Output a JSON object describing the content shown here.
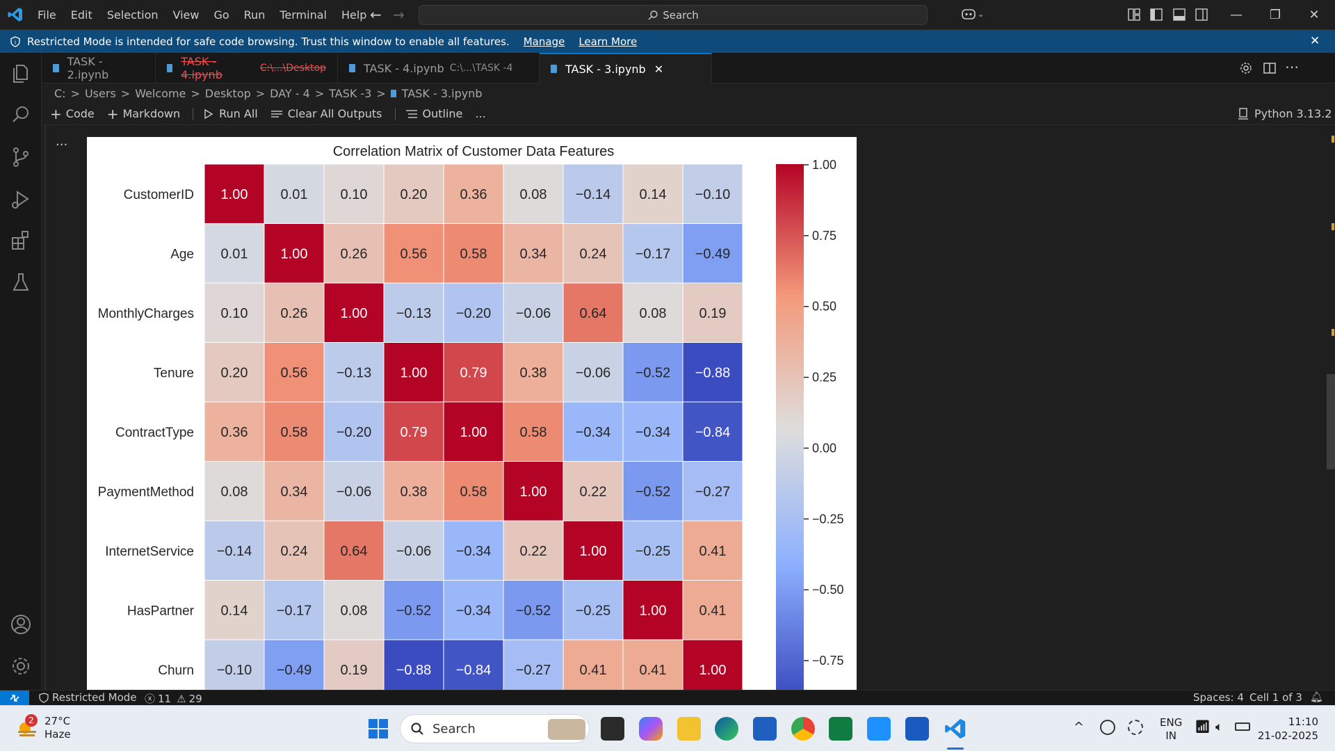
{
  "titlebar": {
    "menu": [
      "File",
      "Edit",
      "Selection",
      "View",
      "Go",
      "Run",
      "Terminal",
      "Help"
    ],
    "search_placeholder": "Search"
  },
  "banner": {
    "text": "Restricted Mode is intended for safe code browsing. Trust this window to enable all features.",
    "manage": "Manage",
    "learn_more": "Learn More"
  },
  "tabs": [
    {
      "label": "TASK - 2.ipynb",
      "desc": "",
      "state": "normal"
    },
    {
      "label": "TASK - 4.ipynb",
      "desc": "C:\\...\\Desktop",
      "state": "deleted"
    },
    {
      "label": "TASK - 4.ipynb",
      "desc": "C:\\...\\TASK -4",
      "state": "normal"
    },
    {
      "label": "TASK - 3.ipynb",
      "desc": "",
      "state": "active"
    }
  ],
  "breadcrumb": [
    "C:",
    "Users",
    "Welcome",
    "Desktop",
    "DAY - 4",
    "TASK -3",
    "TASK - 3.ipynb"
  ],
  "toolbar": {
    "code": "Code",
    "markdown": "Markdown",
    "run_all": "Run All",
    "clear_outputs": "Clear All Outputs",
    "outline": "Outline",
    "more": "...",
    "kernel": "Python 3.13.2"
  },
  "cell_more": "...",
  "chart_data": {
    "type": "heatmap",
    "title": "Correlation Matrix of Customer Data Features",
    "rows": [
      "CustomerID",
      "Age",
      "MonthlyCharges",
      "Tenure",
      "ContractType",
      "PaymentMethod",
      "InternetService",
      "HasPartner",
      "Churn"
    ],
    "values": [
      [
        1.0,
        0.01,
        0.1,
        0.2,
        0.36,
        0.08,
        -0.14,
        0.14,
        -0.1
      ],
      [
        0.01,
        1.0,
        0.26,
        0.56,
        0.58,
        0.34,
        0.24,
        -0.17,
        -0.49
      ],
      [
        0.1,
        0.26,
        1.0,
        -0.13,
        -0.2,
        -0.06,
        0.64,
        0.08,
        0.19
      ],
      [
        0.2,
        0.56,
        -0.13,
        1.0,
        0.79,
        0.38,
        -0.06,
        -0.52,
        -0.88
      ],
      [
        0.36,
        0.58,
        -0.2,
        0.79,
        1.0,
        0.58,
        -0.34,
        -0.34,
        -0.84
      ],
      [
        0.08,
        0.34,
        -0.06,
        0.38,
        0.58,
        1.0,
        0.22,
        -0.52,
        -0.27
      ],
      [
        -0.14,
        0.24,
        0.64,
        -0.06,
        -0.34,
        0.22,
        1.0,
        -0.25,
        0.41
      ],
      [
        0.14,
        -0.17,
        0.08,
        -0.52,
        -0.34,
        -0.52,
        -0.25,
        1.0,
        0.41
      ],
      [
        -0.1,
        -0.49,
        0.19,
        -0.88,
        -0.84,
        -0.27,
        0.41,
        0.41,
        1.0
      ]
    ],
    "colormap": "coolwarm",
    "colorbar_ticks": [
      "1.00",
      "0.75",
      "0.50",
      "0.25",
      "0.00",
      "−0.25",
      "−0.50",
      "−0.75"
    ],
    "colorbar_tick_values": [
      1.0,
      0.75,
      0.5,
      0.25,
      0.0,
      -0.25,
      -0.5,
      -0.75
    ],
    "vmin": -0.88,
    "vmax": 1.0
  },
  "statusbar": {
    "restricted": "Restricted Mode",
    "errors": "11",
    "warnings": "29",
    "spaces": "Spaces: 4",
    "cell": "Cell 1 of 3"
  },
  "taskbar": {
    "weather_temp": "27°C",
    "weather_desc": "Haze",
    "weather_badge": "2",
    "search": "Search",
    "lang1": "ENG",
    "lang2": "IN",
    "time": "11:10",
    "date": "21-02-2025"
  },
  "colors": {
    "accent": "#0078d4",
    "banner": "#0e4a7a"
  }
}
